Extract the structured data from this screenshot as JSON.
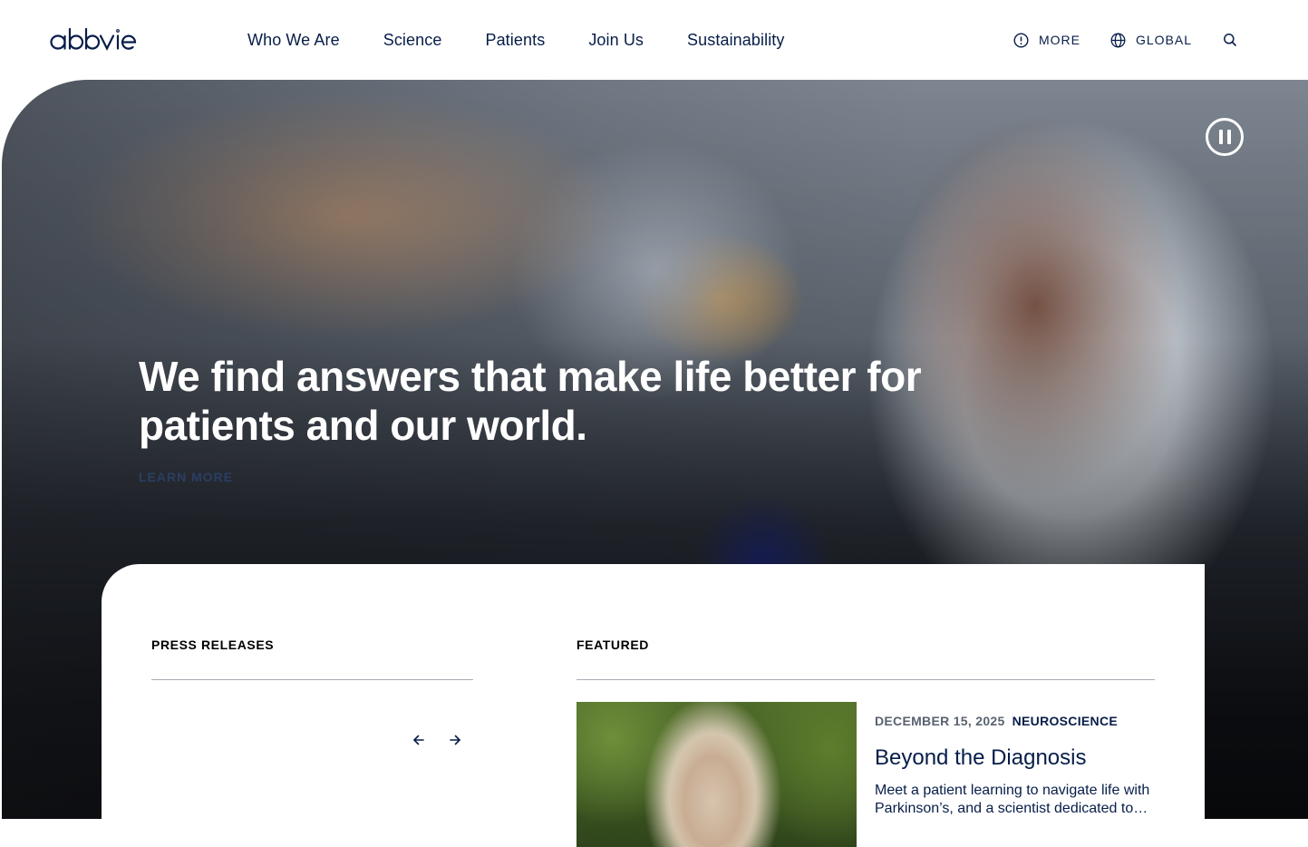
{
  "brand": {
    "logo_text": "abbvie"
  },
  "nav": {
    "items": [
      {
        "label": "Who We Are"
      },
      {
        "label": "Science"
      },
      {
        "label": "Patients"
      },
      {
        "label": "Join Us"
      },
      {
        "label": "Sustainability"
      }
    ]
  },
  "utility": {
    "more_label": "MORE",
    "global_label": "GLOBAL"
  },
  "hero": {
    "headline": "We find answers that make life better for patients and our world.",
    "cta_label": "LEARN MORE"
  },
  "press_releases": {
    "heading": "PRESS RELEASES"
  },
  "featured": {
    "heading": "FEATURED",
    "date": "DECEMBER 15, 2025",
    "category": "NEUROSCIENCE",
    "title": "Beyond the Diagnosis",
    "description": "Meet a patient learning to navigate life with Parkinson’s, and a scientist dedicated to…"
  },
  "colors": {
    "brand_navy": "#071d49",
    "white": "#ffffff",
    "divider": "#a9adb4"
  },
  "icons": {
    "more": "info-circle-icon",
    "global": "globe-icon",
    "search": "search-icon",
    "pause": "pause-icon",
    "prev": "arrow-left-icon",
    "next": "arrow-right-icon"
  }
}
